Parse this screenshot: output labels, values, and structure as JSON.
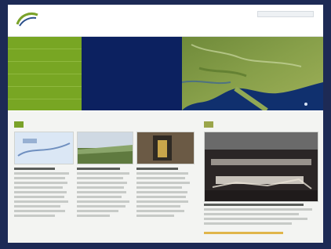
{
  "header": {
    "logo_icon": "green-swoosh-logo",
    "logo_text": "",
    "title": "",
    "search_placeholder": "",
    "top_link": ""
  },
  "nav": {
    "items": [
      {
        "label": ""
      },
      {
        "label": ""
      },
      {
        "label": ""
      },
      {
        "label": ""
      },
      {
        "label": ""
      }
    ]
  },
  "hero": {
    "title": "",
    "body": "",
    "more_link": ""
  },
  "sections": [
    {
      "tag": ""
    },
    {
      "tag": ""
    }
  ],
  "colors": {
    "frame": "#1d2a55",
    "nav_green": "#78a623",
    "hero_navy": "#0b1e5c",
    "tag_green": "#7aa229"
  }
}
